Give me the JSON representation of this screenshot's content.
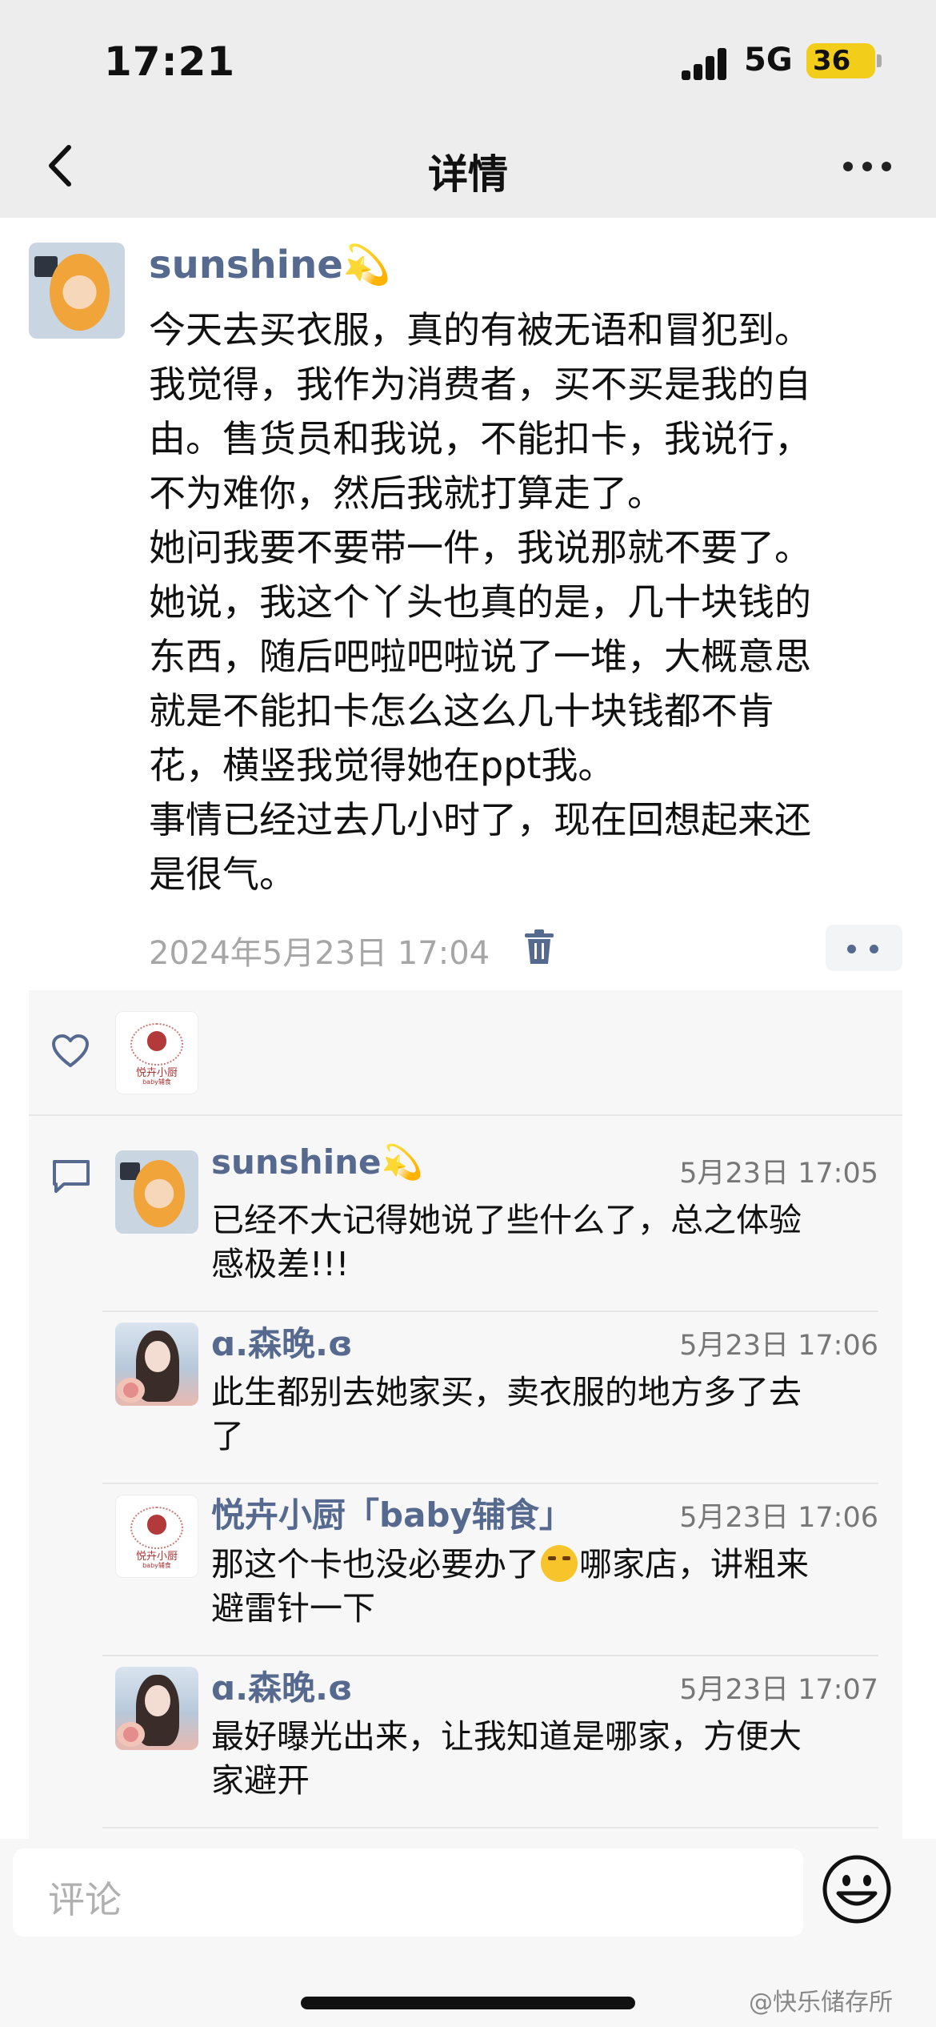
{
  "status": {
    "time": "17:21",
    "network": "5G",
    "battery": "36"
  },
  "nav": {
    "title": "详情"
  },
  "post": {
    "author": "sunshine",
    "author_emoji": "💫",
    "text": "今天去买衣服，真的有被无语和冒犯到。\n我觉得，我作为消费者，买不买是我的自\n由。售货员和我说，不能扣卡，我说行，\n不为难你，然后我就打算走了。\n她问我要不要带一件，我说那就不要了。\n她说，我这个丫头也真的是，几十块钱的\n东西，随后吧啦吧啦说了一堆，大概意思\n就是不能扣卡怎么这么几十块钱都不肯\n花，横竖我觉得她在ppt我。\n事情已经过去几小时了，现在回想起来还\n是很气。",
    "timestamp": "2024年5月23日 17:04"
  },
  "likes": {
    "liker_logo_text": "悦卉小厨",
    "liker_logo_sub": "baby辅食"
  },
  "comments": [
    {
      "name": "sunshine",
      "emoji": "💫",
      "time": "5月23日 17:05",
      "text": "已经不大记得她说了些什么了，总之体验\n感极差!!!"
    },
    {
      "name": "ɑ.森晚.ɞ",
      "time": "5月23日 17:06",
      "text": "此生都别去她家买，卖衣服的地方多了去\n了"
    },
    {
      "name": "悦卉小厨「baby辅食」",
      "time": "5月23日 17:06",
      "text_before": "那这个卡也没必要办了",
      "text_after": "哪家店，讲粗来\n避雷针一下"
    },
    {
      "name": "ɑ.森晚.ɞ",
      "time": "5月23日 17:07",
      "text": "最好曝光出来，让我知道是哪家，方便大\n家避开"
    }
  ],
  "composer": {
    "placeholder": "评论"
  },
  "watermark": "@快乐储存所",
  "colors": {
    "name_blue": "#56698e",
    "header_bg": "#ededed",
    "comment_bg": "#f7f7f7"
  }
}
